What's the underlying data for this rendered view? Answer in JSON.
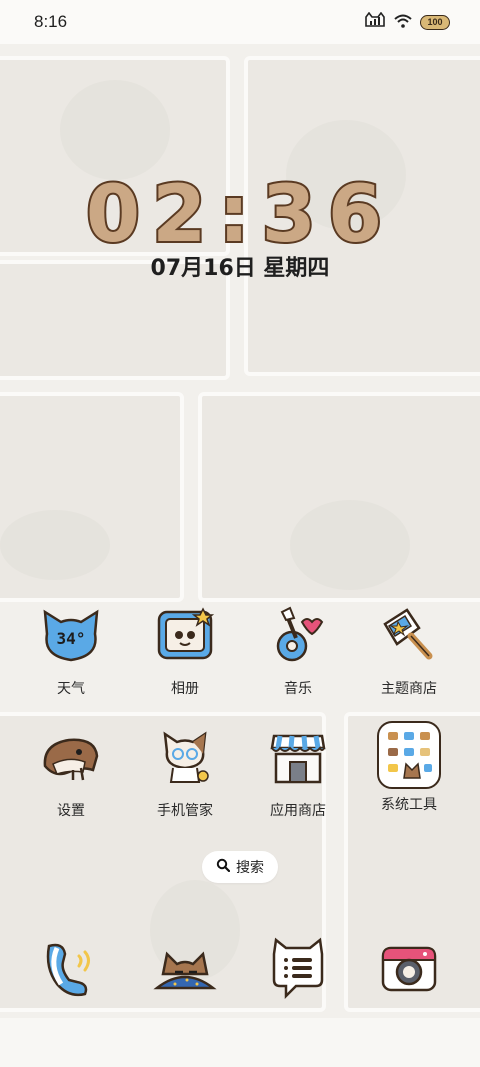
{
  "status_bar": {
    "time": "8:16",
    "battery": "100",
    "icons": [
      "cat-signal-icon",
      "wifi-icon",
      "battery-icon"
    ]
  },
  "lockscreen": {
    "clock": "02:36",
    "date": "07月16日 星期四"
  },
  "apps": [
    {
      "label": "天气",
      "icon": "weather-cat-icon",
      "icon_text": "34°"
    },
    {
      "label": "相册",
      "icon": "photo-frame-icon"
    },
    {
      "label": "音乐",
      "icon": "guitar-icon"
    },
    {
      "label": "主题商店",
      "icon": "paintbrush-icon"
    },
    {
      "label": "设置",
      "icon": "hamster-icon"
    },
    {
      "label": "手机管家",
      "icon": "cat-guardian-icon"
    },
    {
      "label": "应用商店",
      "icon": "shop-icon"
    },
    {
      "label": "系统工具",
      "icon": "tools-folder-icon"
    }
  ],
  "search": {
    "label": "搜索"
  },
  "dock": [
    {
      "icon": "phone-icon"
    },
    {
      "icon": "cat-sleeping-icon"
    },
    {
      "icon": "message-cat-icon"
    },
    {
      "icon": "camera-icon"
    }
  ],
  "colors": {
    "outline": "#3b2a1c",
    "accent_blue": "#5aa9e6",
    "clock_fill": "#cba885",
    "clock_stroke": "#5a3a22"
  }
}
